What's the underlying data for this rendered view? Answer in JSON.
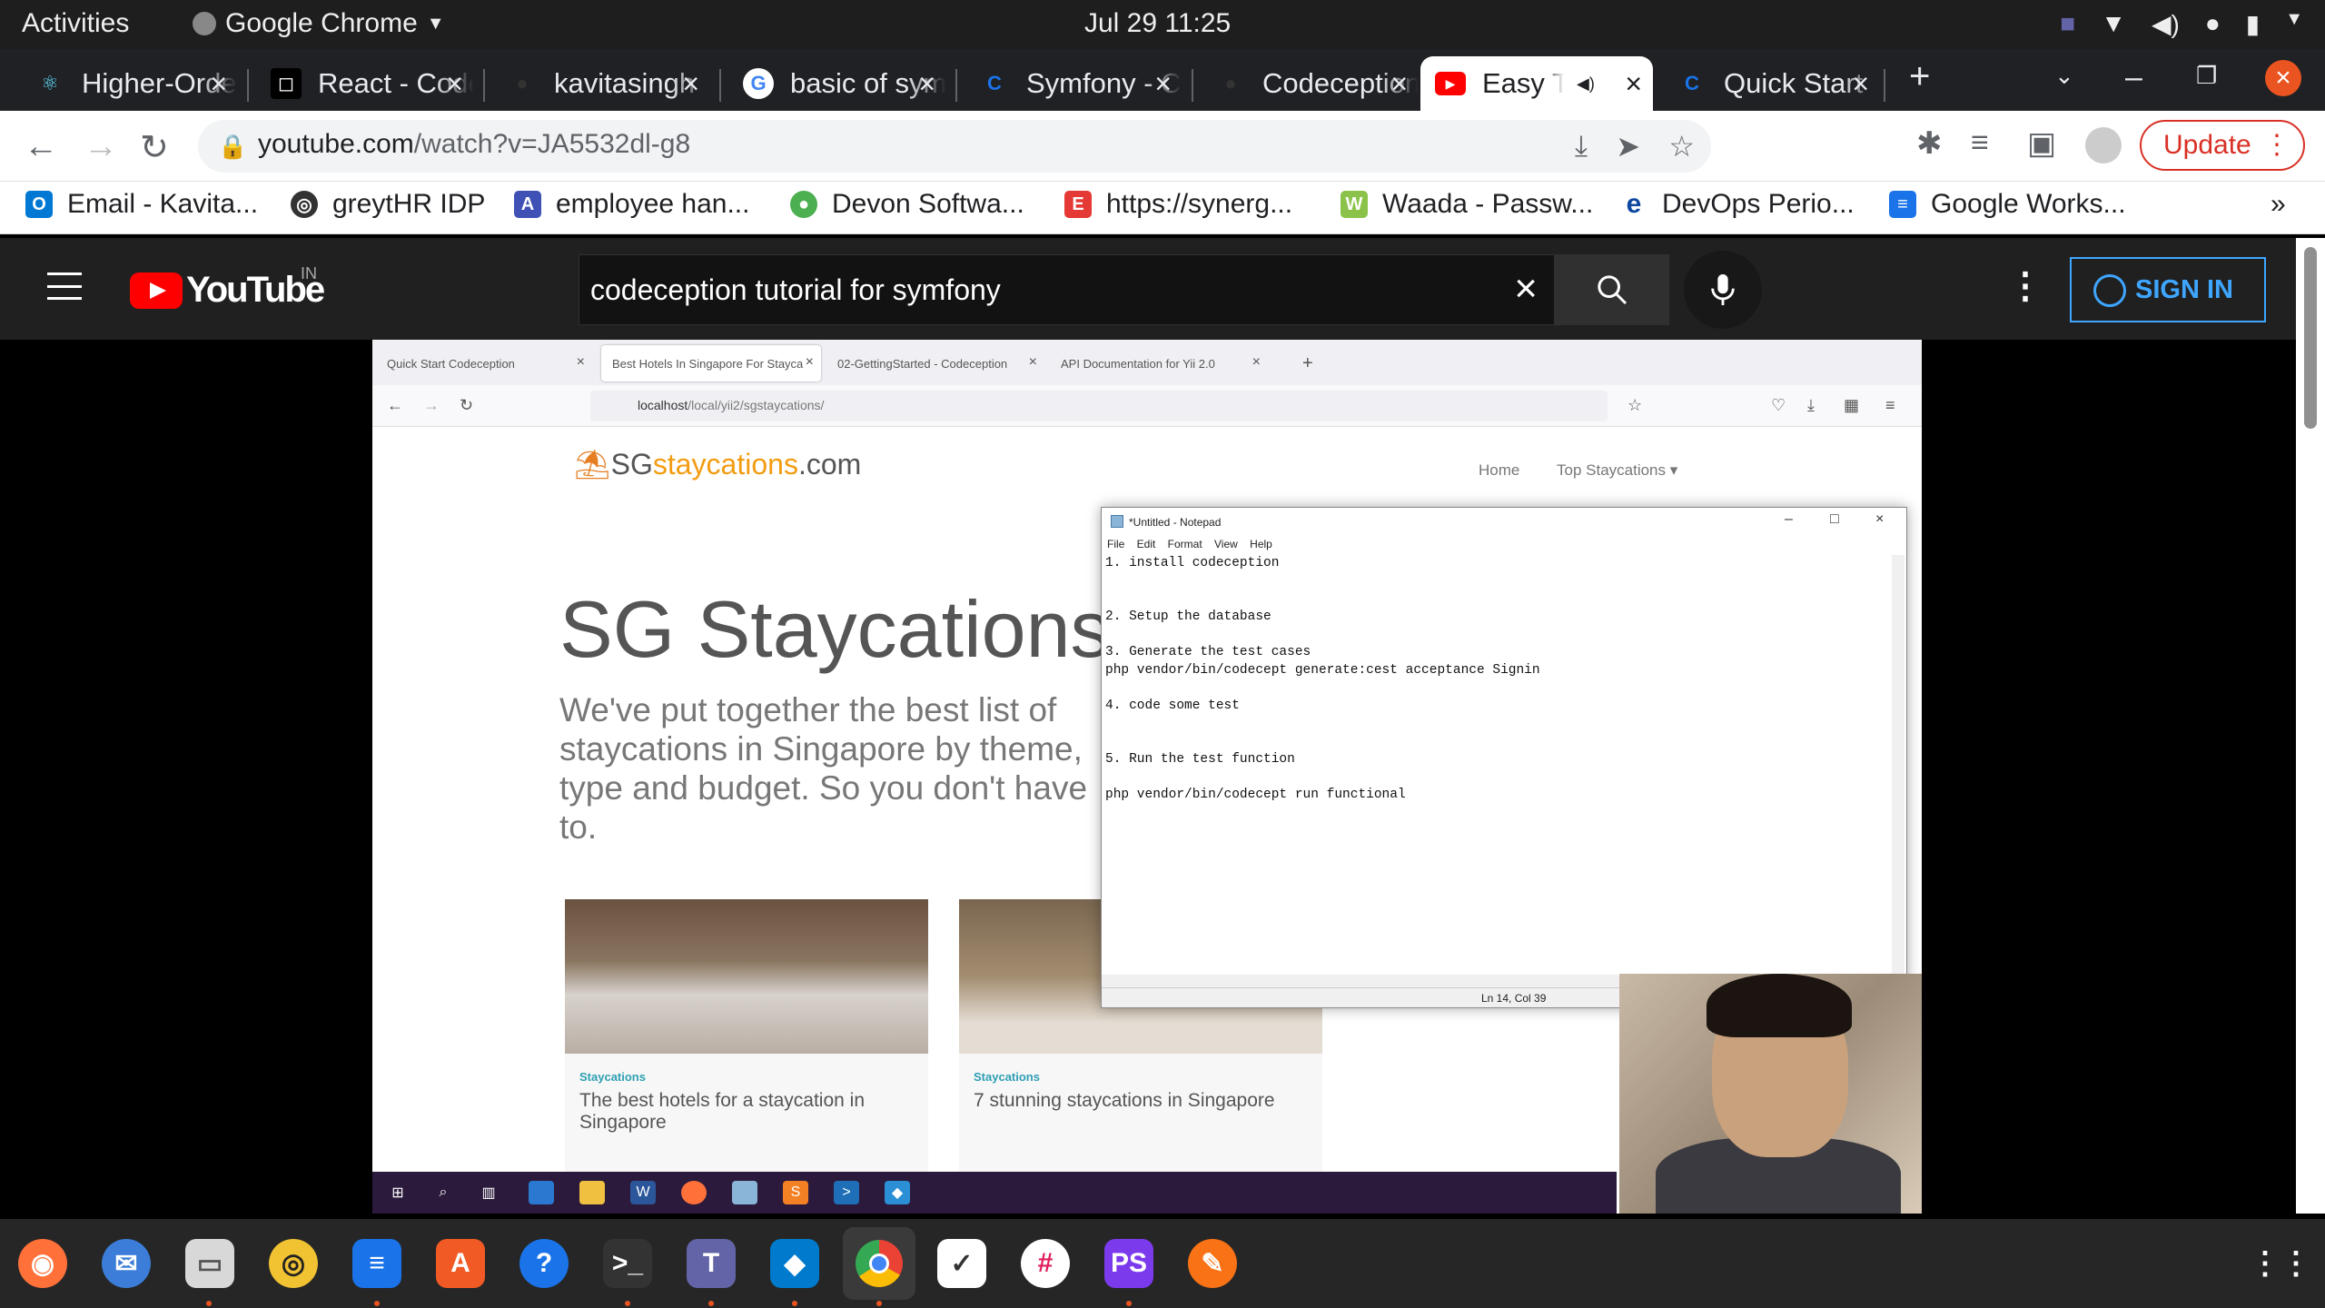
{
  "topbar": {
    "activities": "Activities",
    "app_name": "Google Chrome",
    "datetime": "Jul 29  11:25"
  },
  "tabs": [
    {
      "title": "Higher-Order",
      "color": "#61dafb",
      "glyph": "⚛"
    },
    {
      "title": "React - Code",
      "color": "#000000",
      "glyph": "◻"
    },
    {
      "title": "kavitasingh",
      "color": "#2b2b2b",
      "glyph": "●"
    },
    {
      "title": "basic of sym",
      "color": "#4285f4",
      "glyph": "G"
    },
    {
      "title": "Symfony - C",
      "color": "#1a73e8",
      "glyph": "C"
    },
    {
      "title": "Codeception",
      "color": "#2b2b2b",
      "glyph": "●"
    },
    {
      "title": "Easy Tutorial",
      "color": "#ff0000",
      "glyph": "▶"
    },
    {
      "title": "Quick Start",
      "color": "#1a73e8",
      "glyph": "C"
    }
  ],
  "address": {
    "host": "youtube.com",
    "path": "/watch?v=JA5532dl-g8",
    "update_label": "Update"
  },
  "bookmarks": [
    {
      "label": "Email - Kavita...",
      "color": "#0078d4",
      "glyph": "O"
    },
    {
      "label": "greytHR IDP",
      "color": "#333333",
      "glyph": "◎"
    },
    {
      "label": "employee han...",
      "color": "#3f51b5",
      "glyph": "A"
    },
    {
      "label": "Devon Softwa...",
      "color": "#4caf50",
      "glyph": "●"
    },
    {
      "label": "https://synerg...",
      "color": "#e53935",
      "glyph": "E"
    },
    {
      "label": "Waada - Passw...",
      "color": "#8bc34a",
      "glyph": "W"
    },
    {
      "label": "DevOps Perio...",
      "color": "#0d47a1",
      "glyph": "e"
    },
    {
      "label": "Google Works...",
      "color": "#1a73e8",
      "glyph": "≡"
    }
  ],
  "youtube": {
    "logo": "YouTube",
    "country": "IN",
    "query": "codeception tutorial for symfony",
    "signin": "SIGN IN"
  },
  "video": {
    "ff_tabs": [
      "Quick Start Codeception",
      "Best Hotels In Singapore For Staycations",
      "02-GettingStarted - Codeception",
      "API Documentation for Yii 2.0"
    ],
    "ff_url_host": "localhost",
    "ff_url_path": "/local/yii2/sgstaycations/",
    "site_logo_a": "SG",
    "site_logo_b": "staycations",
    "site_logo_c": ".com",
    "nav_home": "Home",
    "nav_top": "Top Staycations ▾",
    "hero": "SG Staycations",
    "hero_sub": "We've put together the best list of staycations in Singapore by theme, type and budget. So you don't have to.",
    "cards": [
      {
        "tag": "Staycations",
        "caption": "The best hotels for a staycation in Singapore"
      },
      {
        "tag": "Staycations",
        "caption": "7 stunning staycations in Singapore"
      }
    ],
    "notepad": {
      "title": "*Untitled - Notepad",
      "menu": "File Edit Format View Help",
      "text": "1. install codeception\n\n\n2. Setup the database\n\n3. Generate the test cases\nphp vendor/bin/codecept generate:cest acceptance Signin\n\n4. code some test\n\n\n5. Run the test function\n\nphp vendor/bin/codecept run functional",
      "status": "Ln 14, Col 39"
    }
  }
}
